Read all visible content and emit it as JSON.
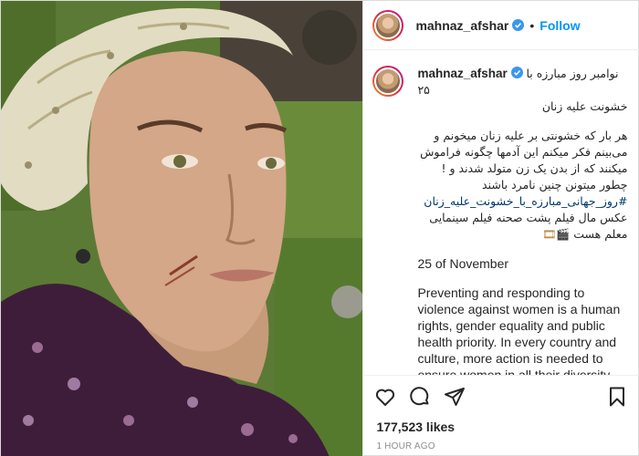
{
  "post": {
    "photo_alt": "",
    "header": {
      "username": "mahnaz_afshar",
      "follow_label": "Follow",
      "separator": "•"
    },
    "caption": {
      "username": "mahnaz_afshar",
      "line1": "نوامبر روز مبارزه با ۲۵",
      "line2": "خشونت علیه زنان",
      "para2": "هر بار که خشونتی بر علیه زنان میخونم و می‌بینم فکر میکنم این آدمها چگونه فراموش میکنند که از بدن یک زن متولد شدند و !چطور میتونن چنین نامرد باشند",
      "hashtag": "#روز_جهانی_مبارزه_با_خشونت_علیه_زنان",
      "para3_line1": "عکس مال فیلم پشت صحنه فیلم سینمایی",
      "para3_line2": "معلم هست",
      "para3_emoji": "🎬🎞",
      "date_line": "25 of November",
      "english": "Preventing and responding to violence against women is a human rights, gender equality and public health priority. In every country and culture, more action is needed to ensure women in all their diversity live a life free of violence and coercion"
    },
    "actions": {
      "like": "heart-icon",
      "comment": "comment-icon",
      "share": "share-icon",
      "save": "bookmark-icon"
    },
    "likes": "177,523 likes",
    "time": "1 HOUR AGO"
  },
  "colors": {
    "accent": "#0095f6",
    "hashtag": "#00376b",
    "muted": "#8e8e8e",
    "border": "#dbdbdb",
    "verified": "#3897f0"
  }
}
